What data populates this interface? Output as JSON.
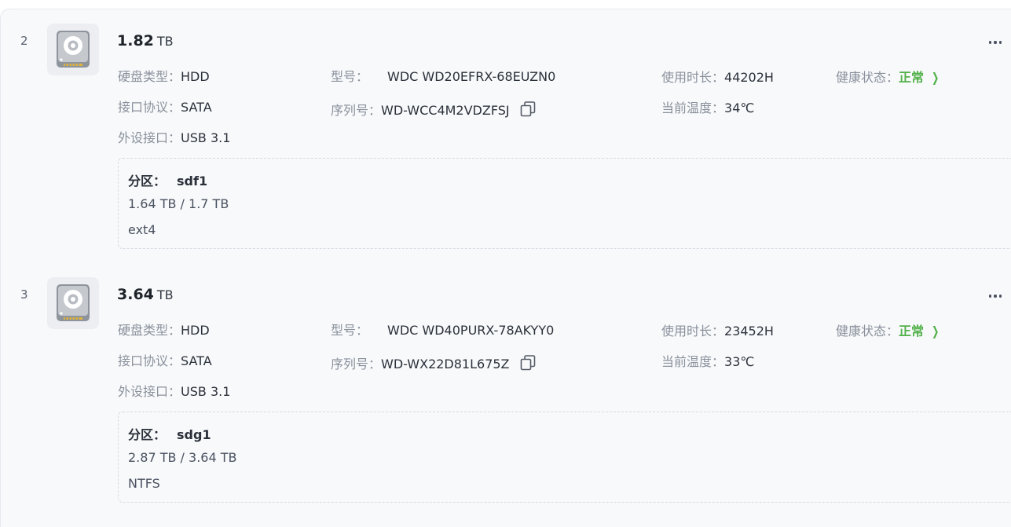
{
  "disks": [
    {
      "index": "2",
      "capacity": "1.82",
      "capacity_unit": "TB",
      "type_label": "硬盘类型：",
      "type_value": "HDD",
      "model_label": "型号：",
      "model_value": "WDC WD20EFRX-68EUZN0",
      "hours_label": "使用时长：",
      "hours_value": "44202H",
      "health_label": "健康状态：",
      "health_value": "正常",
      "protocol_label": "接口协议：",
      "protocol_value": "SATA",
      "serial_label": "序列号：",
      "serial_value": "WD-WCC4M2VDZFSJ",
      "temp_label": "当前温度：",
      "temp_value": "34℃",
      "port_label": "外设接口：",
      "port_value": "USB 3.1",
      "partition": {
        "title": "分区：",
        "name": "sdf1",
        "usage": "1.64 TB / 1.7 TB",
        "fs": "ext4"
      }
    },
    {
      "index": "3",
      "capacity": "3.64",
      "capacity_unit": "TB",
      "type_label": "硬盘类型：",
      "type_value": "HDD",
      "model_label": "型号：",
      "model_value": "WDC WD40PURX-78AKYY0",
      "hours_label": "使用时长：",
      "hours_value": "23452H",
      "health_label": "健康状态：",
      "health_value": "正常",
      "protocol_label": "接口协议：",
      "protocol_value": "SATA",
      "serial_label": "序列号：",
      "serial_value": "WD-WX22D81L675Z",
      "temp_label": "当前温度：",
      "temp_value": "33℃",
      "port_label": "外设接口：",
      "port_value": "USB 3.1",
      "partition": {
        "title": "分区：",
        "name": "sdg1",
        "usage": "2.87 TB / 3.64 TB",
        "fs": "NTFS"
      }
    }
  ],
  "colors": {
    "health_ok": "#52b14a",
    "label": "#8a919c"
  },
  "icons": {
    "disk": "hard-disk-icon",
    "copy": "copy-icon",
    "more": "more-horizontal-icon",
    "chevron": "chevron-right-icon"
  }
}
